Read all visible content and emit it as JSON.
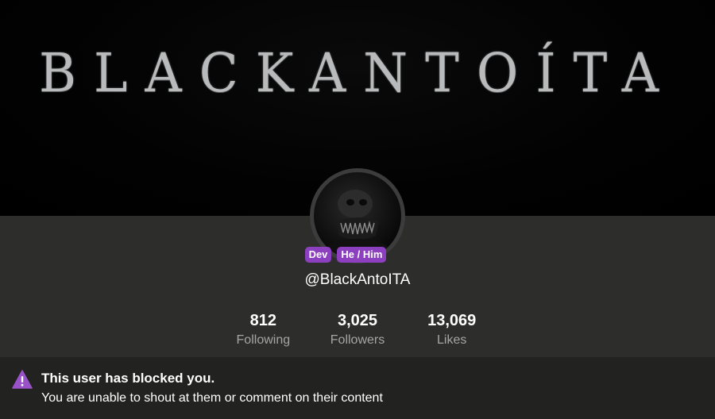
{
  "banner": {
    "title": "BLACKANTOÍTA"
  },
  "profile": {
    "avatar_icon": "avatar-image",
    "badges": [
      {
        "label": "Dev"
      },
      {
        "label": "He / Him"
      }
    ],
    "username": "@BlackAntoITA",
    "stats": [
      {
        "value": "812",
        "label": "Following"
      },
      {
        "value": "3,025",
        "label": "Followers"
      },
      {
        "value": "13,069",
        "label": "Likes"
      }
    ]
  },
  "alert": {
    "icon": "warning-icon",
    "title": "This user has blocked you.",
    "message": "You are unable to shout at them or comment on their content"
  },
  "colors": {
    "badge": "#8c3fbf",
    "background": "#2d2e2c",
    "banner": "#000000",
    "alert_bg": "#222321",
    "warning": "#9a52c9"
  }
}
